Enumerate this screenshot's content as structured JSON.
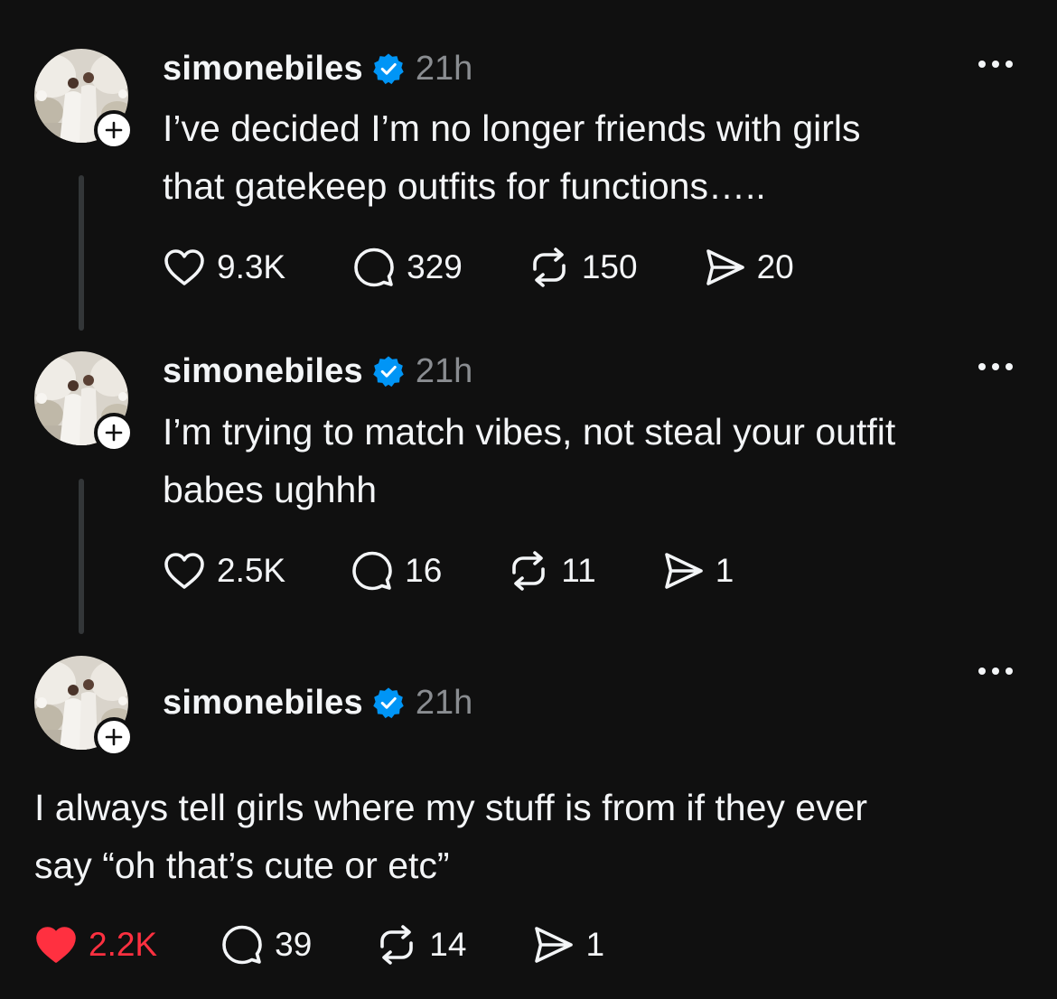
{
  "colors": {
    "background": "#101010",
    "text": "#f3f5f7",
    "muted": "#8a8d91",
    "verified": "#0095f6",
    "like_active": "#ff3040",
    "thread_line": "#333638"
  },
  "posts": [
    {
      "username": "simonebiles",
      "verified_icon": "verified-badge-icon",
      "time": "21h",
      "text_lines": [
        "I’ve decided I’m no longer friends with girls",
        "that gatekeep outfits for functions….."
      ],
      "likes": "9.3K",
      "comments": "329",
      "reposts": "150",
      "shares": "20",
      "liked": false
    },
    {
      "username": "simonebiles",
      "verified_icon": "verified-badge-icon",
      "time": "21h",
      "text_lines": [
        "I’m trying to match vibes, not steal your outfit",
        "babes ughhh"
      ],
      "likes": "2.5K",
      "comments": "16",
      "reposts": "11",
      "shares": "1",
      "liked": false
    },
    {
      "username": "simonebiles",
      "verified_icon": "verified-badge-icon",
      "time": "21h",
      "text_lines": [
        "I always tell girls where my stuff is from if they ever",
        "say “oh that’s cute or etc”"
      ],
      "likes": "2.2K",
      "comments": "39",
      "reposts": "14",
      "shares": "1",
      "liked": true
    }
  ]
}
